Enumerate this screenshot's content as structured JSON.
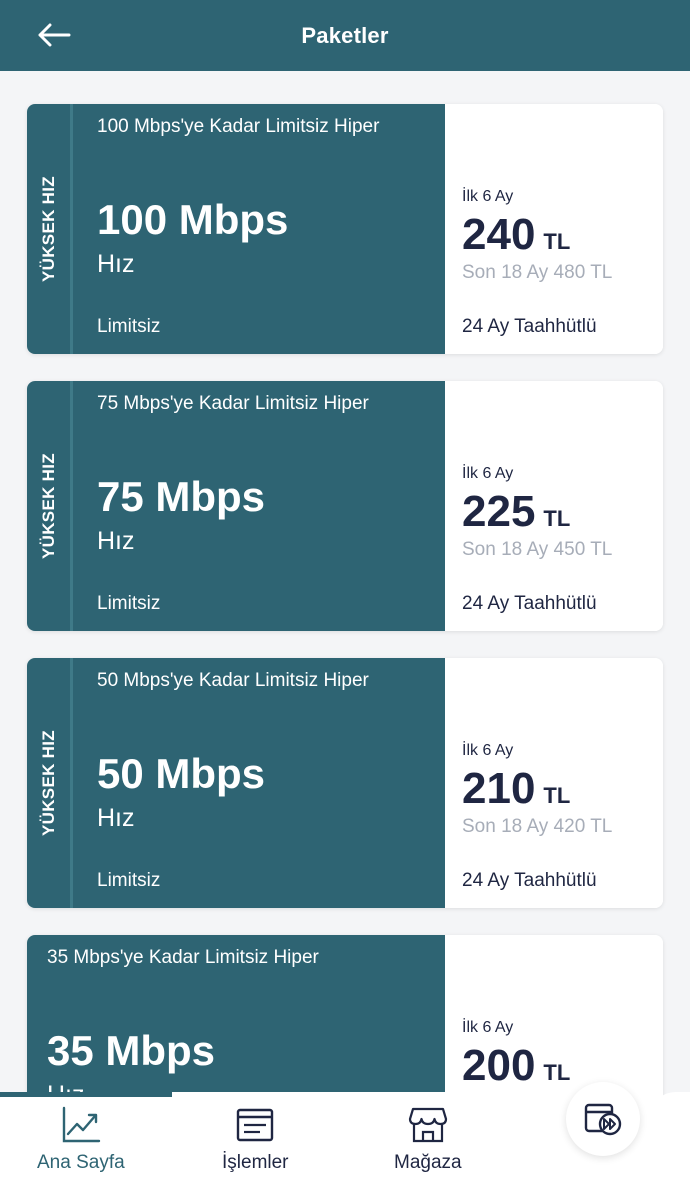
{
  "header": {
    "title": "Paketler",
    "back_icon": "arrow-left-icon"
  },
  "packages": [
    {
      "badge": "YÜKSEK HIZ",
      "name": "100 Mbps'ye Kadar Limitsiz Hiper",
      "speed": "100 Mbps",
      "speed_label": "Hız",
      "limit": "Limitsiz",
      "promo_label": "İlk 6 Ay",
      "price": "240",
      "currency": "TL",
      "later": "Son 18 Ay 480 TL",
      "commitment": "24 Ay Taahhütlü"
    },
    {
      "badge": "YÜKSEK HIZ",
      "name": "75 Mbps'ye Kadar Limitsiz Hiper",
      "speed": "75 Mbps",
      "speed_label": "Hız",
      "limit": "Limitsiz",
      "promo_label": "İlk 6 Ay",
      "price": "225",
      "currency": "TL",
      "later": "Son 18 Ay 450 TL",
      "commitment": "24 Ay Taahhütlü"
    },
    {
      "badge": "YÜKSEK HIZ",
      "name": "50 Mbps'ye Kadar Limitsiz Hiper",
      "speed": "50 Mbps",
      "speed_label": "Hız",
      "limit": "Limitsiz",
      "promo_label": "İlk 6 Ay",
      "price": "210",
      "currency": "TL",
      "later": "Son 18 Ay 420 TL",
      "commitment": "24 Ay Taahhütlü"
    },
    {
      "badge": "",
      "name": "35 Mbps'ye Kadar Limitsiz Hiper",
      "speed": "35 Mbps",
      "speed_label": "Hız",
      "limit": "",
      "promo_label": "İlk 6 Ay",
      "price": "200",
      "currency": "TL",
      "later": "",
      "commitment": ""
    }
  ],
  "bottom_nav": {
    "items": [
      {
        "label": "Ana Sayfa",
        "icon": "chart-line-icon",
        "active": true
      },
      {
        "label": "İşlemler",
        "icon": "list-window-icon",
        "active": false
      },
      {
        "label": "Mağaza",
        "icon": "store-icon",
        "active": false
      }
    ],
    "fab_icon": "fast-forward-screen-icon"
  },
  "colors": {
    "primary": "#2e6473",
    "text_dark": "#1f2642",
    "text_muted": "#a7adb8",
    "background": "#f4f5f7"
  }
}
